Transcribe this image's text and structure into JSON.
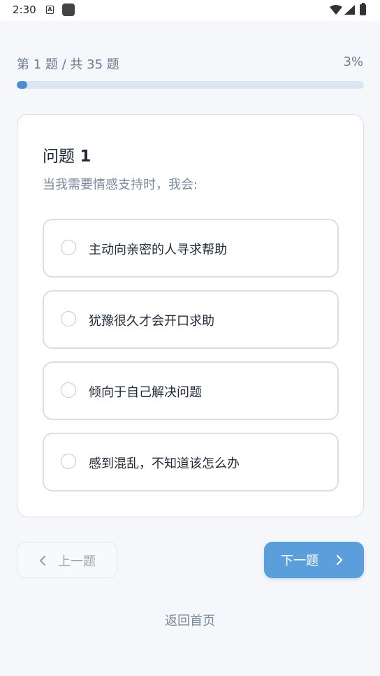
{
  "status_bar": {
    "time": "2:30",
    "a_icon_text": "A"
  },
  "progress": {
    "label": "第 1 题 / 共 35 题",
    "percent_text": "3%",
    "fraction": 0.03
  },
  "question": {
    "title_prefix": "问题 ",
    "number": "1",
    "text": "当我需要情感支持时，我会:"
  },
  "options": [
    {
      "label": "主动向亲密的人寻求帮助",
      "selected": false
    },
    {
      "label": "犹豫很久才会开口求助",
      "selected": false
    },
    {
      "label": "倾向于自己解决问题",
      "selected": false
    },
    {
      "label": "感到混乱，不知道该怎么办",
      "selected": false
    }
  ],
  "nav": {
    "prev_label": "上一题",
    "next_label": "下一题"
  },
  "home_link": "返回首页",
  "colors": {
    "accent": "#5a9fdc",
    "progress_fill": "#4a8fd4",
    "progress_track": "#dbe6f2",
    "background": "#f5f7fb"
  }
}
